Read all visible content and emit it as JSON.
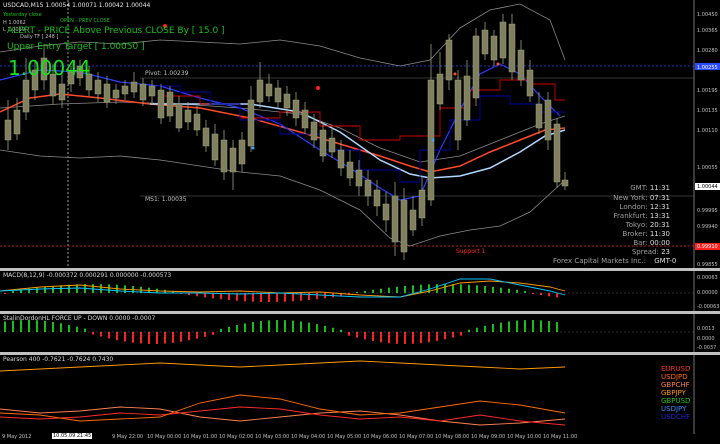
{
  "main": {
    "symbol_header": "USDCAD,M15  1.00054 1.00071 1.00042 1.00044",
    "small_lines": [
      "Yesterday close",
      "OPEN - PREV CLOSE",
      "H 1.0062",
      "L 1.0019",
      "Daily TF [ 248 ]"
    ],
    "alert_text": "ALERT - PRICE Above Previous CLOSE By [ 15.0 ]",
    "upper_entry": "Upper Entry Target [ 1.00050 ]",
    "big_price": "1.00044",
    "pivot_label": "Pivot: 1.00239",
    "ms1_label": "MS1: 1.00035",
    "support_label": "Support 1",
    "price_scale": [
      "1.00450",
      "1.00365",
      "1.00280",
      "1.00255",
      "1.00195",
      "1.00135",
      "1.00110",
      "1.00055",
      "1.00044",
      "0.99995",
      "0.99940",
      "0.99910",
      "0.99855"
    ],
    "info_panel": [
      {
        "label": "GMT:",
        "value": "11:31"
      },
      {
        "label": "New York:",
        "value": "07:31"
      },
      {
        "label": "London:",
        "value": "12:31"
      },
      {
        "label": "Frankfurt:",
        "value": "13:31"
      },
      {
        "label": "Tokyo:",
        "value": "20:31"
      },
      {
        "label": "Broker:",
        "value": "11:30"
      },
      {
        "label": "Bar:",
        "value": "00:00"
      },
      {
        "label": "Spread:",
        "value": "23"
      }
    ],
    "broker_name": "Forex Capital Markets Inc.:",
    "broker_tz": "GMT-0"
  },
  "macd": {
    "header": "MACD(8,12,9)  -0.000372 0.000291 0.000000 -0.000573",
    "scale": [
      "0.00063",
      "0.00000",
      "-0.00063"
    ]
  },
  "force": {
    "header": "StalinDordonHL FORCE UP - DOWN  0.0000 -0.0007",
    "scale": [
      "0.0013",
      "0.0000",
      "-0.0037"
    ]
  },
  "pearson": {
    "header": "Pearson 400  -0.7621 -0.7624 0.7430",
    "legend": [
      {
        "name": "EURUSD",
        "color": "#ff2a2a"
      },
      {
        "name": "USDJPD",
        "color": "#ff6a00"
      },
      {
        "name": "GBPCHF",
        "color": "#ff7f50"
      },
      {
        "name": "GBPJPY",
        "color": "#ff9900"
      },
      {
        "name": "GBPUSD",
        "color": "#19c019"
      },
      {
        "name": "USDJPY",
        "color": "#3c8cff"
      },
      {
        "name": "USDCHF",
        "color": "#2222cc"
      }
    ]
  },
  "time_axis": [
    "9 May 2012",
    "9 May 21:45",
    "9 May 22:00",
    "10 May 00:00",
    "10 May 01:00",
    "10 May 02:00",
    "10 May 03:00",
    "10 May 04:00",
    "10 May 05:00",
    "10 May 06:00",
    "10 May 07:00",
    "10 May 08:00",
    "10 May 09:00",
    "10 May 10:00",
    "10 May 11:00"
  ],
  "time_cursor": "10.05.09 21:45"
}
